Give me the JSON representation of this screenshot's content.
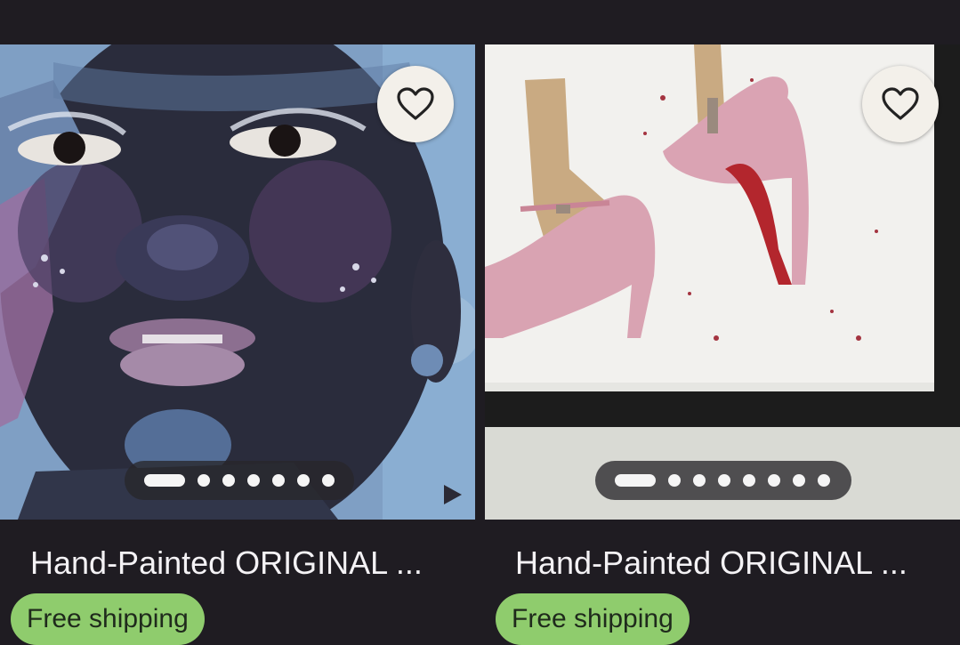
{
  "listings": [
    {
      "title": "Hand-Painted ORIGINAL ...",
      "badge": "Free shipping",
      "favorite_icon": "heart-outline-icon",
      "image_count": 7,
      "active_image": 1,
      "has_video": true
    },
    {
      "title": "Hand-Painted ORIGINAL ...",
      "badge": "Free shipping",
      "favorite_icon": "heart-outline-icon",
      "image_count": 8,
      "active_image": 1,
      "has_video": false
    }
  ],
  "colors": {
    "background": "#1f1c22",
    "badge": "#8fcc6d",
    "badge_text": "#1f2a1c",
    "title_text": "#f4f2f5",
    "favorite_bg": "#f3f0ea"
  }
}
